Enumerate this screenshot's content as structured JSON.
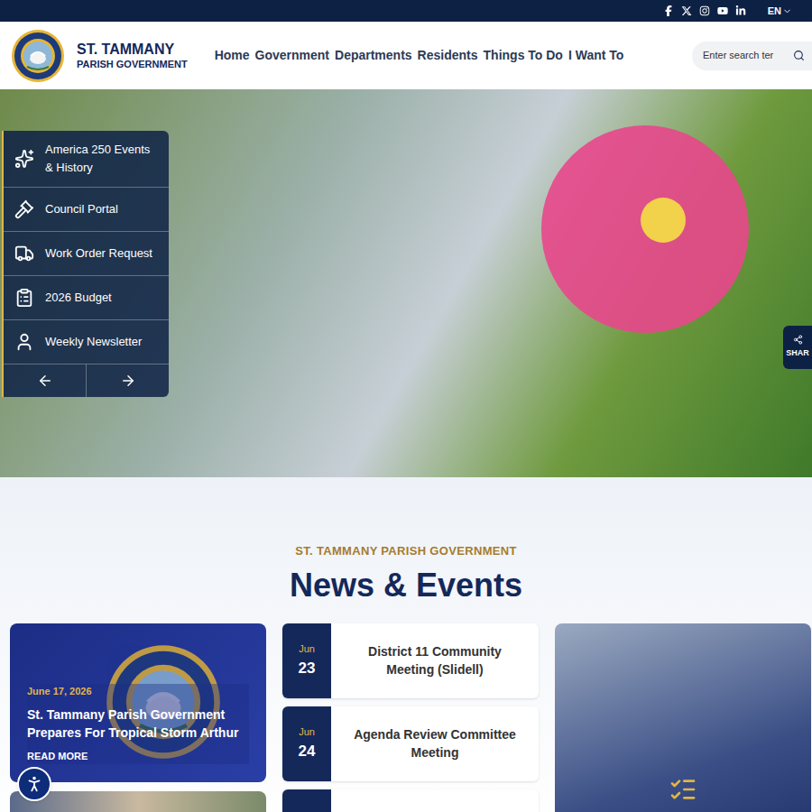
{
  "topbar": {
    "language": "EN"
  },
  "header": {
    "logo_title": "ST. TAMMANY",
    "logo_subtitle": "PARISH GOVERNMENT",
    "nav": [
      {
        "label": "Home"
      },
      {
        "label": "Government"
      },
      {
        "label": "Departments"
      },
      {
        "label": "Residents"
      },
      {
        "label": "Things To Do"
      },
      {
        "label": "I Want To"
      }
    ],
    "search": {
      "placeholder": "Enter search ter"
    }
  },
  "quick_links": [
    {
      "label": "America 250 Events & History"
    },
    {
      "label": "Council Portal"
    },
    {
      "label": "Work Order Request"
    },
    {
      "label": "2026 Budget"
    },
    {
      "label": "Weekly Newsletter"
    }
  ],
  "share": {
    "label": "SHAR"
  },
  "section": {
    "eyebrow": "ST. TAMMANY PARISH GOVERNMENT",
    "title": "News & Events"
  },
  "featured_news": {
    "date": "June 17, 2026",
    "title": "St. Tammany Parish Government Prepares For Tropical Storm Arthur",
    "link": "READ MORE"
  },
  "events": [
    {
      "month": "Jun",
      "day": "23",
      "title": "District 11 Community Meeting (Slidell)"
    },
    {
      "month": "Jun",
      "day": "24",
      "title": "Agenda Review Committee Meeting"
    }
  ]
}
